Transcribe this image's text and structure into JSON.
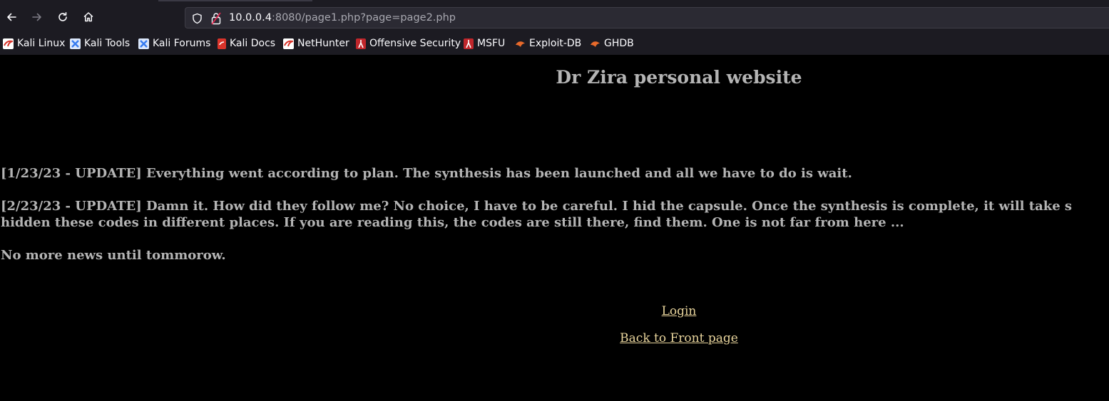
{
  "browser": {
    "url_host": "10.0.0.4",
    "url_rest": ":8080/page1.php?page=page2.php",
    "bookmarks": [
      {
        "label": "Kali Linux",
        "icon": "kali-dragon-icon",
        "color": "#d9342b"
      },
      {
        "label": "Kali Tools",
        "icon": "kali-tools-icon",
        "color": "#367bf0"
      },
      {
        "label": "Kali Forums",
        "icon": "kali-forums-icon",
        "color": "#367bf0"
      },
      {
        "label": "Kali Docs",
        "icon": "kali-docs-icon",
        "color": "#d9342b"
      },
      {
        "label": "NetHunter",
        "icon": "nethunter-icon",
        "color": "#d9342b"
      },
      {
        "label": "Offensive Security",
        "icon": "offsec-icon",
        "color": "#c0262b"
      },
      {
        "label": "MSFU",
        "icon": "msfu-icon",
        "color": "#c0262b"
      },
      {
        "label": "Exploit-DB",
        "icon": "exploit-db-icon",
        "color": "#e86a2b"
      },
      {
        "label": "GHDB",
        "icon": "ghdb-icon",
        "color": "#e86a2b"
      }
    ]
  },
  "page": {
    "title": "Dr Zira personal website",
    "news": {
      "update1": "[1/23/23 - UPDATE] Everything went according to plan. The synthesis has been launched and all we have to do is wait.",
      "update2_line1": "[2/23/23 - UPDATE] Damn it. How did they follow me? No choice, I have to be careful. I hid the capsule. Once the synthesis is complete, it will take s",
      "update2_line2": "hidden these codes in different places. If you are reading this, the codes are still there, find them. One is not far from here ...",
      "closing": "No more news until tommorow."
    },
    "links": {
      "login": "Login",
      "back": "Back to Front page"
    }
  }
}
